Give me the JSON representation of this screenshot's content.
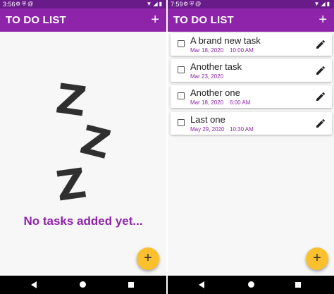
{
  "left_screen": {
    "status_bar": {
      "time": "3:56",
      "icons": [
        "settings-icon",
        "shield-icon",
        "at-icon"
      ],
      "right_icons": [
        "wifi-icon",
        "signal-icon",
        "battery-icon"
      ]
    },
    "app_bar": {
      "title": "TO DO LIST",
      "add_label": "+"
    },
    "empty_state": {
      "z1": "Z",
      "z2": "Z",
      "z3": "Z",
      "message": "No tasks added yet..."
    },
    "fab_label": "+"
  },
  "right_screen": {
    "status_bar": {
      "time": "7:59",
      "icons": [
        "settings-icon",
        "shield-icon",
        "at-icon"
      ],
      "right_icons": [
        "wifi-icon",
        "signal-icon",
        "battery-icon"
      ]
    },
    "app_bar": {
      "title": "TO DO LIST",
      "add_label": "+"
    },
    "tasks": [
      {
        "name": "A brand new task",
        "date": "Mar 18, 2020",
        "time": "10:00 AM"
      },
      {
        "name": "Another task",
        "date": "Mar 23, 2020",
        "time": ""
      },
      {
        "name": "Another one",
        "date": "Mar 18, 2020",
        "time": "6:00 AM"
      },
      {
        "name": "Last one",
        "date": "May 29, 2020",
        "time": "10:30 AM"
      }
    ],
    "fab_label": "+"
  },
  "colors": {
    "primary": "#8e24aa",
    "primary_dark": "#6a1b8a",
    "accent": "#fbc02d",
    "background": "#f7f7f7"
  }
}
